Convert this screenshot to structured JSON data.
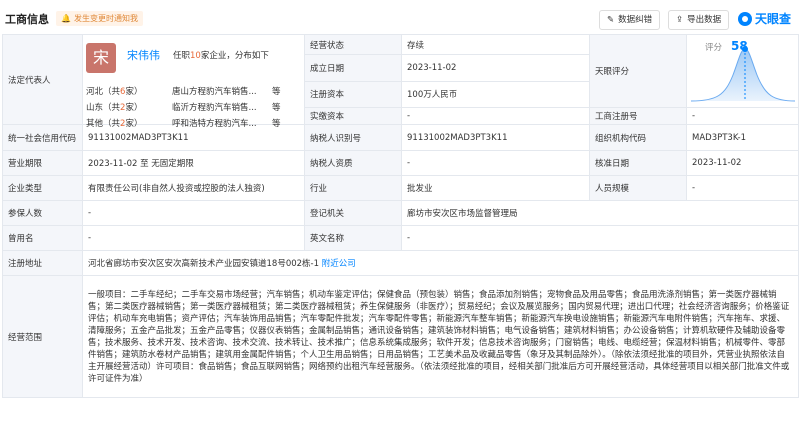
{
  "header": {
    "title": "工商信息",
    "notify_label": "发生变更时通知我",
    "buttons": {
      "correct": "数据纠错",
      "export": "导出数据"
    },
    "logo": "天眼查"
  },
  "colors": {
    "accent": "#0084ff",
    "highlight": "#e86a3a",
    "avatar": "#c9756b",
    "label_bg": "#f4f6fa"
  },
  "legal": {
    "label": "法定代表人",
    "avatar_char": "宋",
    "name": "宋伟伟",
    "desc_pre": "任职",
    "desc_count": "10",
    "desc_post": "家企业，分布如下",
    "regions": [
      {
        "prov": "河北（共",
        "count": "6",
        "suffix": "家）",
        "company": "唐山方程豹汽车销售...",
        "more": "等"
      },
      {
        "prov": "山东（共",
        "count": "2",
        "suffix": "家）",
        "company": "临沂方程豹汽车销售...",
        "more": "等"
      },
      {
        "prov": "其他（共",
        "count": "2",
        "suffix": "家）",
        "company": "呼和浩特方程豹汽车...",
        "more": "等"
      }
    ]
  },
  "rows": {
    "status_label": "经营状态",
    "status": "存续",
    "founded_label": "成立日期",
    "founded": "2023-11-02",
    "capital_label": "注册资本",
    "capital": "100万人民币",
    "paid_label": "实缴资本",
    "paid": "-",
    "score_label": "天眼评分",
    "score_title": "评分",
    "score": "58",
    "regno_label": "工商注册号",
    "regno": "-",
    "credit_label": "统一社会信用代码",
    "credit": "91131002MAD3PT3K11",
    "taxid_label": "纳税人识别号",
    "taxid": "91131002MAD3PT3K11",
    "org_label": "组织机构代码",
    "org": "MAD3PT3K-1",
    "term_label": "营业期限",
    "term": "2023-11-02 至 无固定期限",
    "taxq_label": "纳税人资质",
    "taxq": "-",
    "approve_label": "核准日期",
    "approve": "2023-11-02",
    "type_label": "企业类型",
    "type": "有限责任公司(非自然人投资或控股的法人独资)",
    "industry_label": "行业",
    "industry": "批发业",
    "size_label": "人员规模",
    "size": "-",
    "insured_label": "参保人数",
    "insured": "-",
    "authority_label": "登记机关",
    "authority": "廊坊市安次区市场监督管理局",
    "former_label": "曾用名",
    "former": "-",
    "english_label": "英文名称",
    "english": "-",
    "address_label": "注册地址",
    "address": "河北省廊坊市安次区安次高新技术产业园安镇道18号002栋-1",
    "address_link": "附近公司",
    "scope_label": "经营范围",
    "scope": "一般项目：二手车经纪；二手车交易市场经营；汽车销售；机动车鉴定评估；保健食品（预包装）销售；食品添加剂销售；宠物食品及用品零售；食品用洗涤剂销售；第一类医疗器械销售；第二类医疗器械销售；第一类医疗器械租赁；第二类医疗器械租赁；养生保健服务（非医疗）；贸易经纪；会议及展览服务；国内贸易代理；进出口代理；社会经济咨询服务；价格鉴证评估；机动车充电销售；资产评估；汽车装饰用品销售；汽车零配件批发；汽车零配件零售；新能源汽车整车销售；新能源汽车换电设施销售；新能源汽车电附件销售；汽车拖车、求援、清障服务；五金产品批发；五金产品零售；仪器仪表销售；金属制品销售；通讯设备销售；建筑装饰材料销售；电气设备销售；建筑材料销售；办公设备销售；计算机软硬件及辅助设备零售；技术服务、技术开发、技术咨询、技术交流、技术转让、技术推广；信息系统集成服务；软件开发；信息技术咨询服务；门窗销售；电线、电缆经营；保温材料销售；机械零件、零部件销售；建筑防水卷材产品销售；建筑用金属配件销售；个人卫生用品销售；日用品销售；工艺美术品及收藏品零售（象牙及其制品除外）。（除依法须经批准的项目外，凭营业执照依法自主开展经营活动）许可项目：食品销售；食品互联网销售；网络预约出租汽车经营服务。（依法须经批准的项目，经相关部门批准后方可开展经营活动，具体经营项目以相关部门批准文件或许可证件为准）"
  }
}
